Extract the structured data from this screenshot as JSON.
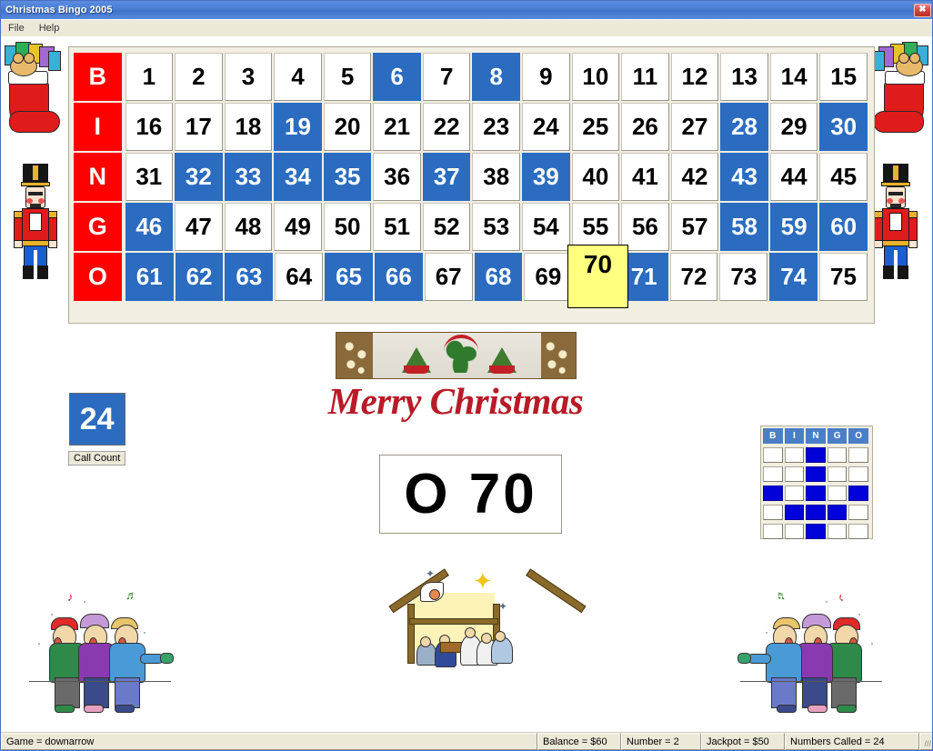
{
  "window": {
    "title": "Christmas Bingo 2005",
    "close_label": "✖"
  },
  "menu": {
    "items": [
      {
        "label": "File"
      },
      {
        "label": "Help"
      }
    ]
  },
  "board": {
    "rows": [
      {
        "letter": "B",
        "numbers": [
          1,
          2,
          3,
          4,
          5,
          6,
          7,
          8,
          9,
          10,
          11,
          12,
          13,
          14,
          15
        ],
        "marked": [
          6,
          8
        ]
      },
      {
        "letter": "I",
        "numbers": [
          16,
          17,
          18,
          19,
          20,
          21,
          22,
          23,
          24,
          25,
          26,
          27,
          28,
          29,
          30
        ],
        "marked": [
          19,
          28,
          30
        ]
      },
      {
        "letter": "N",
        "numbers": [
          31,
          32,
          33,
          34,
          35,
          36,
          37,
          38,
          39,
          40,
          41,
          42,
          43,
          44,
          45
        ],
        "marked": [
          32,
          33,
          34,
          35,
          37,
          39,
          43
        ]
      },
      {
        "letter": "G",
        "numbers": [
          46,
          47,
          48,
          49,
          50,
          51,
          52,
          53,
          54,
          55,
          56,
          57,
          58,
          59,
          60
        ],
        "marked": [
          46,
          58,
          59,
          60
        ]
      },
      {
        "letter": "O",
        "numbers": [
          61,
          62,
          63,
          64,
          65,
          66,
          67,
          68,
          69,
          70,
          71,
          72,
          73,
          74,
          75
        ],
        "marked": [
          61,
          62,
          63,
          65,
          66,
          68,
          71,
          74
        ]
      }
    ],
    "current_number": 70,
    "colors": {
      "header_red": "#fe0000",
      "marked_blue": "#2b6cc0",
      "current_yellow": "#ffff80",
      "board_background": "#f2efe2"
    }
  },
  "call_count": {
    "value": "24",
    "label": "Call Count"
  },
  "banner": {
    "text": "Merry Christmas"
  },
  "call_display": {
    "text": "O 70"
  },
  "mini_card": {
    "headers": [
      "B",
      "I",
      "N",
      "G",
      "O"
    ],
    "pattern": [
      [
        false,
        false,
        true,
        false,
        false
      ],
      [
        false,
        false,
        true,
        false,
        false
      ],
      [
        true,
        false,
        true,
        false,
        true
      ],
      [
        false,
        true,
        true,
        true,
        false
      ],
      [
        false,
        false,
        true,
        false,
        false
      ]
    ]
  },
  "status_bar": {
    "game": "Game = downarrow",
    "balance": "Balance = $60",
    "number": "Number = 2",
    "jackpot": "Jackpot = $50",
    "numbers_called": "Numbers Called = 24"
  },
  "decorations": {
    "stocking_left": "christmas-stocking-with-gifts",
    "stocking_right": "christmas-stocking-with-gifts",
    "nutcracker_left": "nutcracker-soldier",
    "nutcracker_right": "nutcracker-soldier",
    "carolers_left": "christmas-carolers-singing",
    "carolers_right": "christmas-carolers-singing",
    "nativity": "nativity-scene",
    "bells_banner": "christmas-bells-banner"
  }
}
